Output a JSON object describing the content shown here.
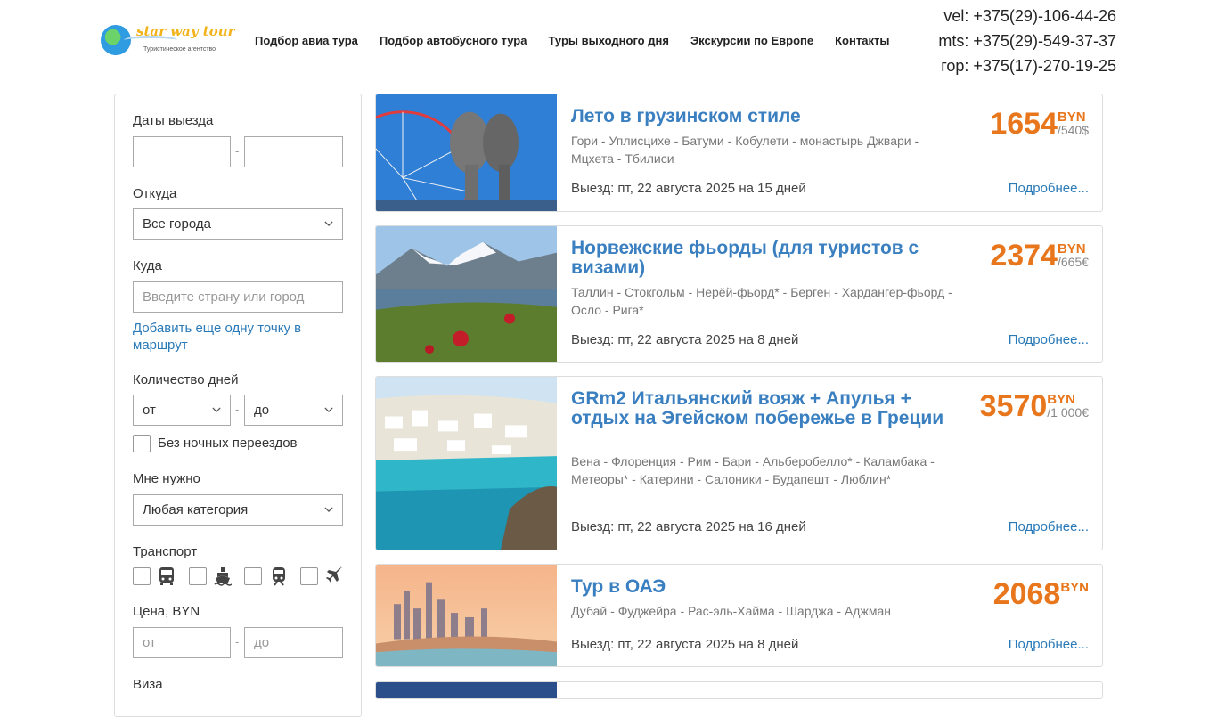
{
  "header": {
    "logo": {
      "brand": "star way tour",
      "tagline": "Туристическое агентство"
    },
    "nav": [
      {
        "label": "Подбор авиа тура"
      },
      {
        "label": "Подбор автобусного тура"
      },
      {
        "label": "Туры выходного дня"
      },
      {
        "label": "Экскурсии по Европе"
      },
      {
        "label": "Контакты"
      }
    ],
    "phones": [
      "vel: +375(29)-106-44-26",
      "mts: +375(29)-549-37-37",
      "гор: +375(17)-270-19-25"
    ]
  },
  "filter": {
    "dates_label": "Даты выезда",
    "dash": "-",
    "from_label": "Откуда",
    "from_value": "Все города",
    "to_label": "Куда",
    "to_placeholder": "Введите страну или город",
    "add_point_link": "Добавить еще одну точку в маршрут",
    "days_label": "Количество дней",
    "days_from": "от",
    "days_to": "до",
    "no_night_label": "Без ночных переездов",
    "need_label": "Мне нужно",
    "need_value": "Любая категория",
    "transport_label": "Транспорт",
    "transport_icons": [
      "bus-icon",
      "ship-icon",
      "train-icon",
      "plane-icon"
    ],
    "price_label": "Цена, BYN",
    "price_from_placeholder": "от",
    "price_to_placeholder": "до",
    "visa_label": "Виза"
  },
  "tours": [
    {
      "title": "Лето в грузинском стиле",
      "route": "Гори - Уплисцихе - Батуми - Кобулети - монастырь Джвари - Мцхета - Тбилиси",
      "departure": "Выезд: пт, 22 августа 2025 на 15 дней",
      "price": "1654",
      "currency": "BYN",
      "alt_price": "/540$",
      "more": "Подробнее..."
    },
    {
      "title": "Норвежские фьорды (для туристов с визами)",
      "route": "Таллин - Стокгольм - Нерёй-фьорд* - Берген - Хардангер-фьорд - Осло - Рига*",
      "departure": "Выезд: пт, 22 августа 2025 на 8 дней",
      "price": "2374",
      "currency": "BYN",
      "alt_price": "/665€",
      "more": "Подробнее..."
    },
    {
      "title": "GRm2 Итальянский вояж + Апулья + отдых на Эгейском побережье в Греции",
      "route": "Вена - Флоренция - Рим - Бари - Альберобелло* - Каламбака - Метеоры* - Катерини - Салоники - Будапешт - Люблин*",
      "departure": "Выезд: пт, 22 августа 2025 на 16 дней",
      "price": "3570",
      "currency": "BYN",
      "alt_price": "/1 000€",
      "more": "Подробнее..."
    },
    {
      "title": "Тур в ОАЭ",
      "route": "Дубай - Фуджейра - Рас-эль-Хайма - Шарджа - Аджман",
      "departure": "Выезд: пт, 22 августа 2025 на 8 дней",
      "price": "2068",
      "currency": "BYN",
      "alt_price": "",
      "more": "Подробнее..."
    }
  ],
  "colors": {
    "accent_blue": "#3a7fc0",
    "price_orange": "#e8761c",
    "link_blue": "#2a7ab8"
  }
}
